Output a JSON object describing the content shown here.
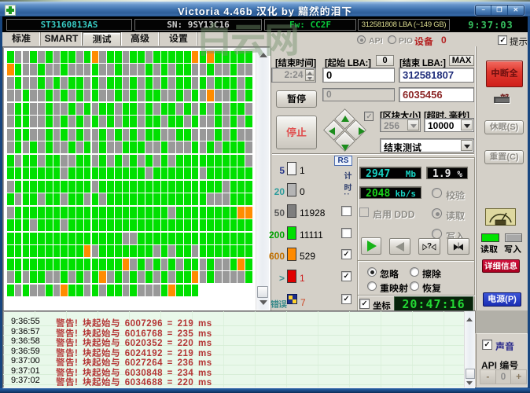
{
  "window": {
    "title": "Victoria 4.46b 汉化  by 黯然的泪下",
    "minimize": "–",
    "maximize": "❐",
    "close": "✕"
  },
  "status": {
    "model": "ST3160813AS",
    "sn": "SN: 9SY13C16",
    "fw": "Fw: CC2F",
    "lba": "312581808 LBA (~149 GB)",
    "clock": "9:37:03"
  },
  "tabs": [
    {
      "label": "标准",
      "active": false
    },
    {
      "label": "SMART",
      "active": false
    },
    {
      "label": "测试",
      "active": true
    },
    {
      "label": "高级",
      "active": false
    },
    {
      "label": "设置",
      "active": false
    }
  ],
  "toolbar": {
    "api": "API",
    "pio": "PIO",
    "device_label": "设备",
    "device_num": "0",
    "hint": "提示"
  },
  "watermark": "白云网",
  "grid": {
    "colors": {
      "g": "#00e000",
      "a": "#999999",
      "O": "#ff8c00"
    },
    "rows": [
      "gaagagaggagOaggaggagggggOgOggggg",
      "Ogaagaagaaagaagaaagagaggaagaagaa",
      "agaagagaggagaggagagagaggagagggag",
      "aagaagagagagaagagaggaagagaOaagag",
      "aggaagaagagaggaggagaggagagagagga",
      "aggaagagagagagaggaggaggagaagagag",
      "aggaagagagaagagagaggaaggaaagagaa",
      "agagagaagagagaagggaagaaagagaggga",
      "gaggaggaaggagagagagagaggggggggga",
      "gggggggaggggggggggaggggggagggggg",
      "aggggggggggaggggggggggggggggaggg",
      "gaggaggaggagagggggggggggggaaaggg",
      "aggggggggggggggggggggaggggggggOO",
      "gggagggagggggggggggggggggggggggg",
      "gggggggggggggggaaggggggggggggggg",
      "ggggggggggOagggggggagaggaggggggg",
      "gggggggggggggggOagagagaggagaagOg",
      "agaggaagagagOagagagagaggOagaaaag",
      "gagaagaOggagaggagaaagOggg......."
    ]
  },
  "test": {
    "end_time_label": "[结束时间]",
    "end_time_value": "2:24",
    "start_lba_label": "[起始 LBA:]",
    "start_lba_btn": "0",
    "start_lba_value": "0",
    "end_lba_label": "[结束 LBA:]",
    "end_lba_btn": "MAX",
    "end_lba_value": "312581807",
    "pause_btn": "暂停",
    "paused_value": "0",
    "current_lba": "6035456",
    "stop_btn": "停止",
    "block_size_label": "[区块大小]",
    "block_size_value": "256",
    "timeout_label": "[超时, 毫秒]",
    "timeout_value": "10000",
    "action_value": "结束测试",
    "rs_btn": "RS",
    "seek_q_icon": "▷?◁",
    "seek_end_icon": "▶|◀",
    "timing_vertical": "计时:",
    "legend": [
      {
        "label": "5",
        "color": "#f4f4f4",
        "value": "1",
        "value_color": "#000000",
        "checkbox": null,
        "label_color": "#2b3a8c"
      },
      {
        "label": "20",
        "color": "#b4b4b4",
        "value": "0",
        "value_color": "#000000",
        "checkbox": null,
        "label_color": "#2e9c9c"
      },
      {
        "label": "50",
        "color": "#7e7e7e",
        "value": "11928",
        "value_color": "#000000",
        "checkbox": false,
        "label_color": "#5a5a5a"
      },
      {
        "label": "200",
        "color": "#00e000",
        "value": "11111",
        "value_color": "#000000",
        "checkbox": false,
        "label_color": "#00a000"
      },
      {
        "label": "600",
        "color": "#ff8a00",
        "value": "529",
        "value_color": "#000000",
        "checkbox": true,
        "label_color": "#c07000"
      },
      {
        "label": ">",
        "color": "#e00000",
        "value": "1",
        "value_color": "#cc2020",
        "checkbox": true,
        "label_color": "#3c8c8c"
      }
    ],
    "errors_label": "错误",
    "errors_value": "7",
    "errors_checked": true,
    "lcd_mb": "2947",
    "lcd_mb_unit": "Mb",
    "lcd_pct": "1.9",
    "lcd_pct_unit": "%",
    "lcd_speed": "2048",
    "lcd_speed_unit": "kb/s",
    "enable_label": "启用",
    "enable_suffix": "DDD",
    "mode_radios": [
      {
        "label": "校验",
        "selected": false
      },
      {
        "label": "读取",
        "selected": true
      },
      {
        "label": "写入",
        "selected": false
      }
    ],
    "defect_radios": [
      {
        "label": "忽略",
        "selected": true
      },
      {
        "label": "擦除",
        "selected": false
      },
      {
        "label": "重映射",
        "selected": false
      },
      {
        "label": "恢复",
        "selected": false
      }
    ],
    "coords_label": "坐标",
    "coords_checked": true,
    "clock": "20:47:16"
  },
  "right_panel": {
    "break_all": "中断全部",
    "sleep": "休眠(S)",
    "reset": "重置(C)",
    "read_label": "读取",
    "write_label": "写入",
    "details": "详细信息",
    "power": "电源(P)"
  },
  "bottom_right": {
    "sound": "声音",
    "api_id_label": "API 编号",
    "minus": "-",
    "value": "0",
    "plus": "+"
  },
  "log": {
    "entries": [
      {
        "time": "9:36:55",
        "message": "警告! 块起始与 6007296 = 219 ms"
      },
      {
        "time": "9:36:57",
        "message": "警告! 块起始与 6016768 = 235 ms"
      },
      {
        "time": "9:36:58",
        "message": "警告! 块起始与 6020352 = 220 ms"
      },
      {
        "time": "9:36:59",
        "message": "警告! 块起始与 6024192 = 219 ms"
      },
      {
        "time": "9:37:00",
        "message": "警告! 块起始与 6027264 = 236 ms"
      },
      {
        "time": "9:37:01",
        "message": "警告! 块起始与 6030848 = 234 ms"
      },
      {
        "time": "9:37:02",
        "message": "警告! 块起始与 6034688 = 220 ms"
      }
    ]
  }
}
